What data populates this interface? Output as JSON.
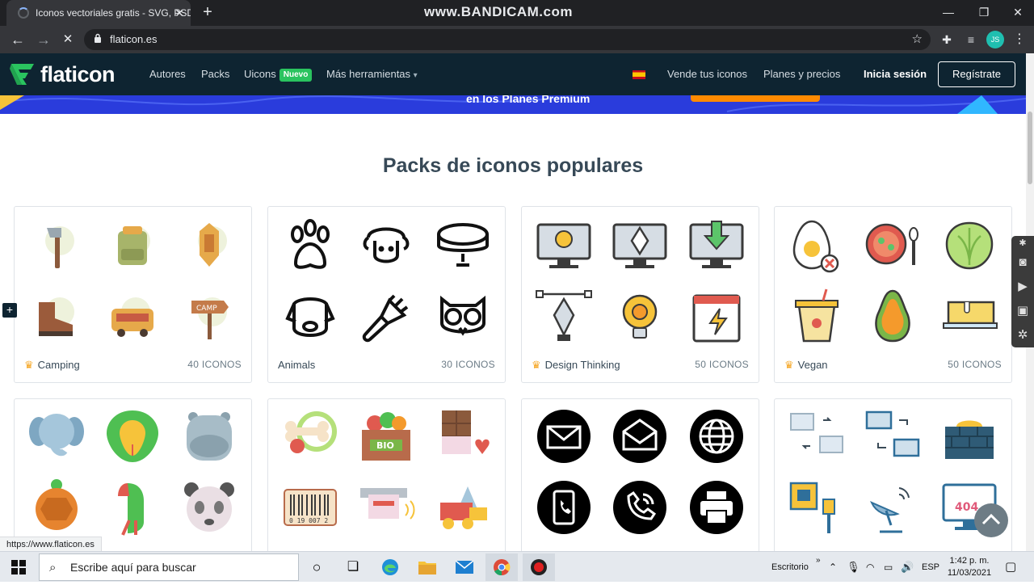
{
  "browser": {
    "tab_title": "Iconos vectoriales gratis - SVG, PSD, PNG, EPS y Fuente de Iconos",
    "tab_close": "✕",
    "new_tab": "+",
    "watermark": "www.BANDICAM.com",
    "window_controls": {
      "minimize": "—",
      "maximize": "❐",
      "close": "✕"
    },
    "nav": {
      "back": "←",
      "forward": "→",
      "reload": "✕"
    },
    "url": "flaticon.es",
    "profile_initials": "JS",
    "status_url": "https://www.flaticon.es"
  },
  "header": {
    "logo_text": "flaticon",
    "nav_items": [
      "Autores",
      "Packs",
      "Uicons",
      "Más herramientas"
    ],
    "uicons_badge": "Nuevo",
    "more_arrow": "▾",
    "sell_link": "Vende tus iconos",
    "plans_link": "Planes y precios",
    "login": "Inicia sesión",
    "register": "Regístrate",
    "colors": {
      "bg": "#0e2431",
      "accent": "#2ac35f"
    }
  },
  "promo": {
    "text": "en los Planes Premium"
  },
  "main": {
    "section_title": "Packs de iconos populares",
    "packs": [
      {
        "name": "Camping",
        "count": "40 ICONOS",
        "premium": true,
        "icons": [
          "axe-icon",
          "backpack-icon",
          "lantern-icon",
          "hiking-boot-icon",
          "camper-van-icon",
          "camp-sign-icon"
        ]
      },
      {
        "name": "Animals",
        "count": "30 ICONOS",
        "premium": false,
        "icons": [
          "paw-icon",
          "sheep-icon",
          "pet-collar-icon",
          "dog-icon",
          "pet-brush-icon",
          "owl-icon"
        ]
      },
      {
        "name": "Design Thinking",
        "count": "50 ICONOS",
        "premium": true,
        "icons": [
          "monitor-idea-icon",
          "monitor-pen-icon",
          "monitor-download-icon",
          "pen-tool-icon",
          "bulb-gear-icon",
          "calendar-bolt-icon"
        ]
      },
      {
        "name": "Vegan",
        "count": "50 ICONOS",
        "premium": true,
        "icons": [
          "no-egg-icon",
          "soup-bowl-icon",
          "lettuce-icon",
          "yogurt-icon",
          "avocado-icon",
          "butter-icon"
        ]
      },
      {
        "name": "",
        "count": "",
        "premium": false,
        "icons": [
          "elephant-icon",
          "snake-icon",
          "hippo-icon",
          "turtle-icon",
          "parrot-icon",
          "panda-icon"
        ]
      },
      {
        "name": "",
        "count": "",
        "premium": false,
        "icons": [
          "dog-bone-icon",
          "bio-crate-icon",
          "chocolate-icon",
          "barcode-icon",
          "card-payment-icon",
          "toy-truck-icon"
        ]
      },
      {
        "name": "",
        "count": "",
        "premium": false,
        "icons": [
          "mail-icon",
          "mail-open-icon",
          "globe-icon",
          "smartphone-call-icon",
          "phone-call-icon",
          "printer-icon"
        ]
      },
      {
        "name": "",
        "count": "",
        "premium": false,
        "icons": [
          "computer-transfer-icon",
          "laptop-transfer-icon",
          "brick-cake-icon",
          "ethernet-icon",
          "satellite-dish-icon",
          "error-404-icon"
        ]
      }
    ]
  },
  "overlay": {
    "side_plus": "+",
    "panel_icons": [
      "screenshot-icon",
      "camera-icon",
      "video-icon",
      "image-icon",
      "settings-icon"
    ]
  },
  "taskbar": {
    "search_placeholder": "Escribe aquí para buscar",
    "apps": [
      "cortana-icon",
      "task-view-icon",
      "edge-icon",
      "file-explorer-icon",
      "mail-app-icon",
      "chrome-icon",
      "bandicam-icon"
    ],
    "desktop_label": "Escritorio",
    "expand": "»",
    "language": "ESP",
    "time": "1:42 p. m.",
    "date": "11/03/2021"
  }
}
